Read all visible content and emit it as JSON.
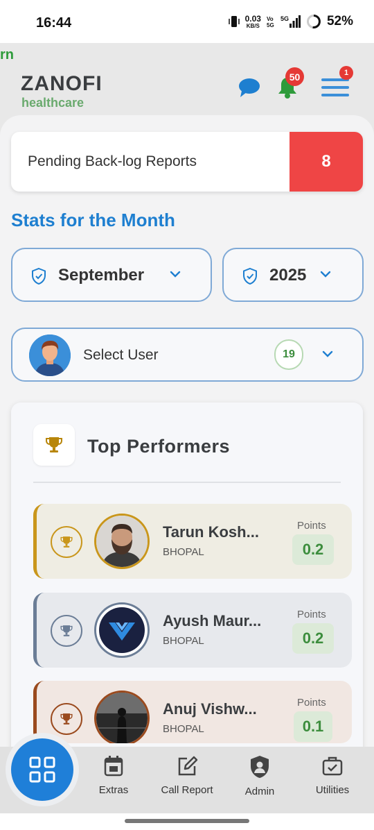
{
  "status_bar": {
    "time": "16:44",
    "net_speed_value": "0.03",
    "net_speed_unit": "KB/S",
    "network": "5G",
    "battery": "52%"
  },
  "header": {
    "marquee_text": "rn",
    "brand_name": "ZANOFI",
    "brand_sub": "healthcare",
    "notification_count": "50",
    "menu_badge_count": "1",
    "colors": {
      "accent": "#1e7fd0",
      "brand_green": "#6aaa6e",
      "badge": "#e53935"
    }
  },
  "pending": {
    "label": "Pending Back-log Reports",
    "count": "8"
  },
  "stats": {
    "title": "Stats for the Month",
    "month": "September",
    "year": "2025"
  },
  "user_select": {
    "placeholder": "Select User",
    "count": "19"
  },
  "top_performers": {
    "title": "Top Performers",
    "rows": [
      {
        "name": "Tarun Kosh...",
        "city": "BHOPAL",
        "points_label": "Points",
        "points": "0.2",
        "rank_color": "#c9961b"
      },
      {
        "name": "Ayush Maur...",
        "city": "BHOPAL",
        "points_label": "Points",
        "points": "0.2",
        "rank_color": "#6b7d96"
      },
      {
        "name": "Anuj Vishw...",
        "city": "BHOPAL",
        "points_label": "Points",
        "points": "0.1",
        "rank_color": "#9a4a1e"
      }
    ]
  },
  "bottom_nav": {
    "items": [
      {
        "label": "Extras",
        "icon": "calendar-icon"
      },
      {
        "label": "Call Report",
        "icon": "edit-icon"
      },
      {
        "label": "Admin",
        "icon": "admin-shield-icon"
      },
      {
        "label": "Utilities",
        "icon": "briefcase-check-icon"
      }
    ]
  }
}
